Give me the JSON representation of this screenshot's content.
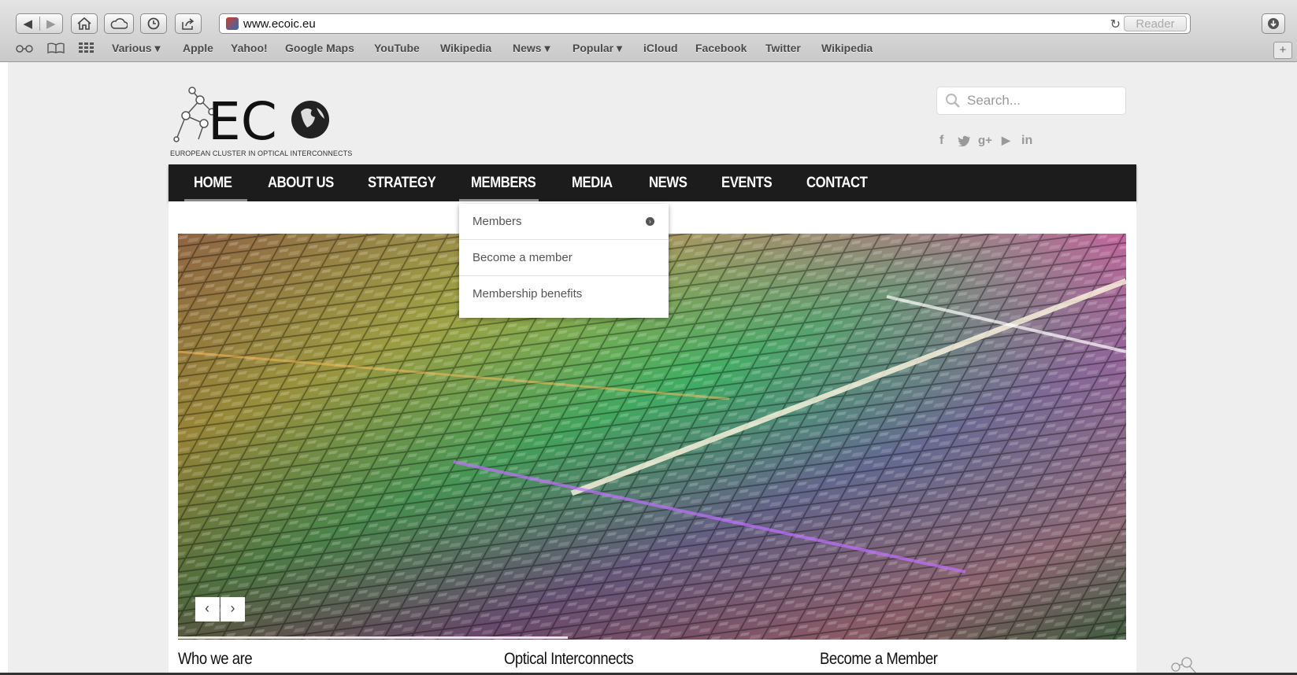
{
  "browser": {
    "url": "www.ecoic.eu",
    "reader_label": "Reader",
    "bookmarks": [
      "Various ▾",
      "Apple",
      "Yahoo!",
      "Google Maps",
      "YouTube",
      "Wikipedia",
      "News ▾",
      "Popular ▾",
      "iCloud",
      "Facebook",
      "Twitter",
      "Wikipedia"
    ]
  },
  "site": {
    "logo_caption": "EUROPEAN CLUSTER IN OPTICAL INTERCONNECTS",
    "search_placeholder": "Search...",
    "social": {
      "facebook": "f",
      "twitter": "🐦",
      "googleplus": "g+",
      "youtube": "▶",
      "linkedin": "in"
    },
    "nav": [
      "HOME",
      "ABOUT US",
      "STRATEGY",
      "MEMBERS",
      "MEDIA",
      "NEWS",
      "EVENTS",
      "CONTACT"
    ],
    "dropdown": [
      "Members",
      "Become a member",
      "Membership benefits"
    ],
    "slider": {
      "prev": "‹",
      "next": "›"
    },
    "columns": [
      "Who we are",
      "Optical Interconnects",
      "Become a Member"
    ]
  },
  "colors": {
    "nav_bg": "#1c1c1c",
    "page_bg": "#eeeeee"
  }
}
